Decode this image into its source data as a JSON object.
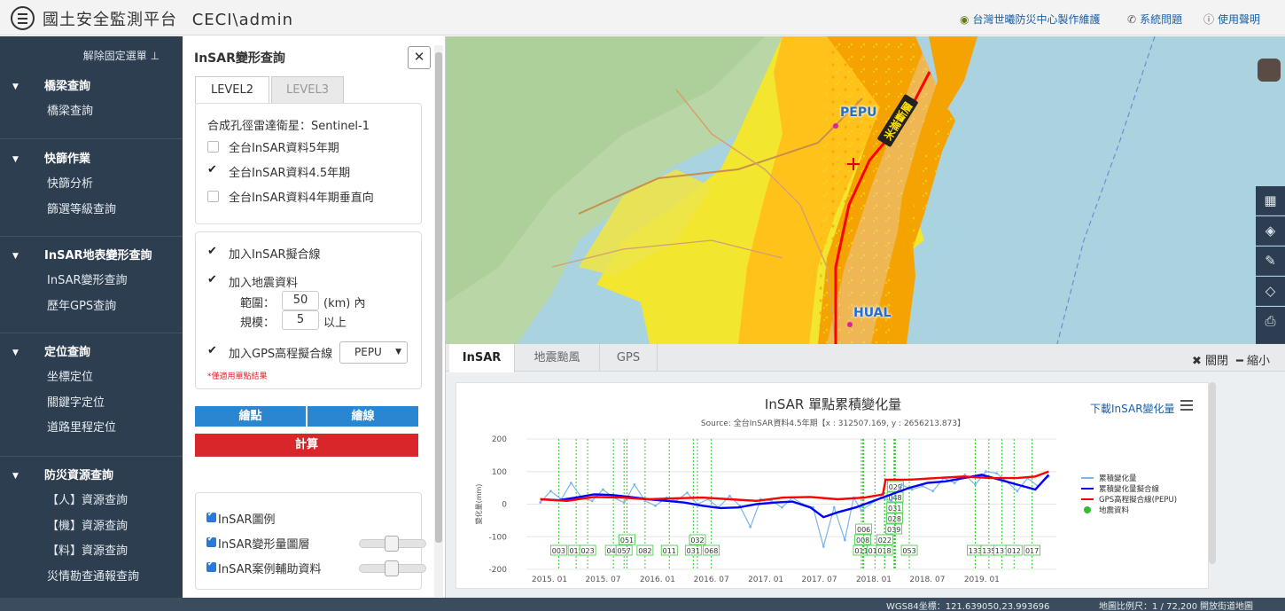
{
  "header": {
    "title": "國土安全監測平台",
    "user": "CECI\\admin",
    "links": [
      {
        "icon": "globe-icon",
        "label": "台灣世曦防災中心製作維護"
      },
      {
        "icon": "phone-icon",
        "label": "系統問題"
      },
      {
        "icon": "help-icon",
        "label": "使用聲明"
      }
    ]
  },
  "sidebar": {
    "unpin_label": "解除固定選單",
    "sections": [
      {
        "title": "橋梁查詢",
        "items": [
          "橋梁查詢"
        ]
      },
      {
        "title": "快篩作業",
        "items": [
          "快篩分析",
          "篩選等級查詢"
        ]
      },
      {
        "title": "InSAR地表變形查詢",
        "items": [
          "InSAR變形查詢",
          "歷年GPS查詢"
        ]
      },
      {
        "title": "定位查詢",
        "items": [
          "坐標定位",
          "關鍵字定位",
          "道路里程定位"
        ]
      },
      {
        "title": "防災資源查詢",
        "items": [
          "【人】資源查詢",
          "【機】資源查詢",
          "【料】資源查詢",
          "災情勘查通報查詢"
        ]
      }
    ]
  },
  "panel": {
    "title": "InSAR變形查詢",
    "tabs": [
      "LEVEL2",
      "LEVEL3"
    ],
    "satellite_label": "合成孔徑雷達衛星：Sentinel-1",
    "datasets": [
      {
        "label": "全台InSAR資料5年期",
        "checked": false
      },
      {
        "label": "全台InSAR資料4.5年期",
        "checked": true
      },
      {
        "label": "全台InSAR資料4年期垂直向",
        "checked": false
      }
    ],
    "add_fit_line": "加入InSAR擬合線",
    "add_quake": "加入地震資料",
    "range_label": "範圍：",
    "range_value": "50",
    "range_unit": "(km) 內",
    "scale_label": "規模：",
    "scale_value": "5",
    "scale_unit": "以上",
    "add_gps": "加入GPS高程擬合線",
    "gps_station": "PEPU",
    "note": "*僅適用單點結果",
    "draw_point": "繪點",
    "draw_line": "繪線",
    "calculate": "計算",
    "layers": [
      {
        "label": "InSAR圖例"
      },
      {
        "label": "InSAR變形量圖層"
      },
      {
        "label": "InSAR案例輔助資料"
      }
    ]
  },
  "map": {
    "labels": [
      {
        "name": "PEPU"
      },
      {
        "name": "HUAL"
      }
    ],
    "fault_label": "米崙斷層",
    "tools": [
      "map-icon",
      "layers-icon",
      "pen-icon",
      "ruler-icon",
      "print-icon"
    ]
  },
  "bottom": {
    "tabs": [
      "InSAR",
      "地震颱風",
      "GPS"
    ],
    "close_label": "關閉",
    "minimize_label": "縮小",
    "download_label": "下載InSAR變化量"
  },
  "chart_data": {
    "type": "line",
    "title": "InSAR 單點累積變化量",
    "subtitle": "Source: 全台InSAR資料4.5年期【x : 312507.169, y : 2656213.873】",
    "ylabel": "變化量(mm)",
    "ylim": [
      -200,
      200
    ],
    "yticks": [
      200,
      100,
      0,
      -100,
      -200
    ],
    "xlim": [
      "2014-10-15",
      "2019-09-10"
    ],
    "xticks": [
      "2015. 01",
      "2015. 07",
      "2016. 01",
      "2016. 07",
      "2017. 01",
      "2017. 07",
      "2018. 01",
      "2018. 07",
      "2019. 01"
    ],
    "series": [
      {
        "name": "累積變化量",
        "color": "#7cb5ec",
        "x": [
          "2014-12-01",
          "2015-01-05",
          "2015-02-10",
          "2015-03-15",
          "2015-04-20",
          "2015-05-25",
          "2015-07-01",
          "2015-08-05",
          "2015-09-10",
          "2015-10-15",
          "2015-11-20",
          "2015-12-25",
          "2016-02-01",
          "2016-03-05",
          "2016-04-10",
          "2016-05-15",
          "2016-06-20",
          "2016-07-25",
          "2016-09-01",
          "2016-10-05",
          "2016-11-10",
          "2016-12-15",
          "2017-01-20",
          "2017-02-25",
          "2017-04-01",
          "2017-05-05",
          "2017-06-10",
          "2017-07-15",
          "2017-08-20",
          "2017-09-25",
          "2017-10-25",
          "2017-11-20",
          "2017-12-20",
          "2018-01-25",
          "2018-03-01",
          "2018-04-05",
          "2018-05-10",
          "2018-06-15",
          "2018-07-20",
          "2018-08-25",
          "2018-10-01",
          "2018-11-05",
          "2018-12-10",
          "2019-01-15",
          "2019-02-20",
          "2019-03-25",
          "2019-05-01",
          "2019-06-05",
          "2019-07-10",
          "2019-08-15"
        ],
        "y": [
          5,
          40,
          15,
          65,
          20,
          10,
          45,
          20,
          5,
          60,
          10,
          -5,
          20,
          10,
          35,
          0,
          15,
          -10,
          25,
          -5,
          -70,
          15,
          10,
          -10,
          20,
          0,
          -10,
          -130,
          -10,
          -110,
          20,
          -20,
          0,
          20,
          10,
          60,
          45,
          55,
          40,
          80,
          65,
          90,
          60,
          100,
          95,
          70,
          40,
          80,
          55,
          85
        ]
      },
      {
        "name": "累積變化量擬合線",
        "color": "#0000ff",
        "x": [
          "2014-12-01",
          "2015-02-01",
          "2015-04-01",
          "2015-06-01",
          "2015-08-01",
          "2015-10-01",
          "2015-12-01",
          "2016-02-01",
          "2016-04-01",
          "2016-06-01",
          "2016-08-01",
          "2016-10-01",
          "2016-12-01",
          "2017-02-01",
          "2017-04-01",
          "2017-06-01",
          "2017-07-15",
          "2017-09-01",
          "2017-11-01",
          "2018-01-01",
          "2018-03-01",
          "2018-05-01",
          "2018-07-01",
          "2018-09-01",
          "2018-11-01",
          "2019-01-01",
          "2019-03-01",
          "2019-05-01",
          "2019-07-01",
          "2019-08-15"
        ],
        "y": [
          15,
          12,
          20,
          30,
          28,
          22,
          15,
          10,
          5,
          -5,
          -12,
          -10,
          0,
          5,
          8,
          -10,
          -40,
          -25,
          -10,
          10,
          30,
          50,
          65,
          70,
          80,
          90,
          75,
          60,
          45,
          90
        ]
      },
      {
        "name": "GPS高程擬合線(PEPU)",
        "color": "#ff0000",
        "x": [
          "2014-12-01",
          "2015-03-01",
          "2015-06-01",
          "2015-09-01",
          "2015-12-01",
          "2016-03-01",
          "2016-06-01",
          "2016-09-01",
          "2016-12-01",
          "2017-03-01",
          "2017-06-01",
          "2017-09-01",
          "2017-12-01",
          "2018-02-01",
          "2018-02-10",
          "2018-05-01",
          "2018-08-01",
          "2018-11-01",
          "2019-02-01",
          "2019-05-01",
          "2019-07-01",
          "2019-08-15"
        ],
        "y": [
          15,
          10,
          22,
          20,
          15,
          18,
          20,
          15,
          10,
          20,
          22,
          15,
          20,
          30,
          75,
          75,
          80,
          85,
          80,
          80,
          85,
          100
        ]
      }
    ],
    "quake_series_name": "地震資料",
    "quakes": [
      {
        "x": "2015-02-01",
        "label": "003"
      },
      {
        "x": "2015-04-01",
        "label": "015"
      },
      {
        "x": "2015-05-10",
        "label": "023"
      },
      {
        "x": "2015-08-05",
        "label": "045"
      },
      {
        "x": "2015-09-10",
        "label": "057"
      },
      {
        "x": "2015-09-20",
        "label": "051"
      },
      {
        "x": "2015-11-20",
        "label": "082"
      },
      {
        "x": "2016-02-10",
        "label": "011"
      },
      {
        "x": "2016-05-01",
        "label": "031"
      },
      {
        "x": "2016-05-15",
        "label": "032"
      },
      {
        "x": "2016-07-01",
        "label": "068"
      },
      {
        "x": "2017-11-20",
        "label": "011"
      },
      {
        "x": "2017-11-25",
        "label": "008"
      },
      {
        "x": "2017-11-28",
        "label": "006"
      },
      {
        "x": "2018-01-05",
        "label": "017"
      },
      {
        "x": "2018-02-06",
        "label": "018"
      },
      {
        "x": "2018-02-07",
        "label": "022"
      },
      {
        "x": "2018-03-10",
        "label": "039"
      },
      {
        "x": "2018-03-12",
        "label": "028"
      },
      {
        "x": "2018-03-13",
        "label": "031"
      },
      {
        "x": "2018-03-14",
        "label": "048"
      },
      {
        "x": "2018-03-15",
        "label": "029"
      },
      {
        "x": "2018-05-01",
        "label": "053"
      },
      {
        "x": "2018-12-10",
        "label": "133"
      },
      {
        "x": "2019-01-25",
        "label": "135"
      },
      {
        "x": "2019-03-10",
        "label": "137"
      },
      {
        "x": "2019-04-20",
        "label": "012"
      },
      {
        "x": "2019-06-20",
        "label": "017"
      }
    ],
    "legend_position": "right"
  },
  "status": {
    "coord_label": "WGS84坐標：121.639050,23.993696",
    "scale_label": "地圖比例尺：1 / 72,200",
    "basemap_label": "開放街道地圖"
  }
}
